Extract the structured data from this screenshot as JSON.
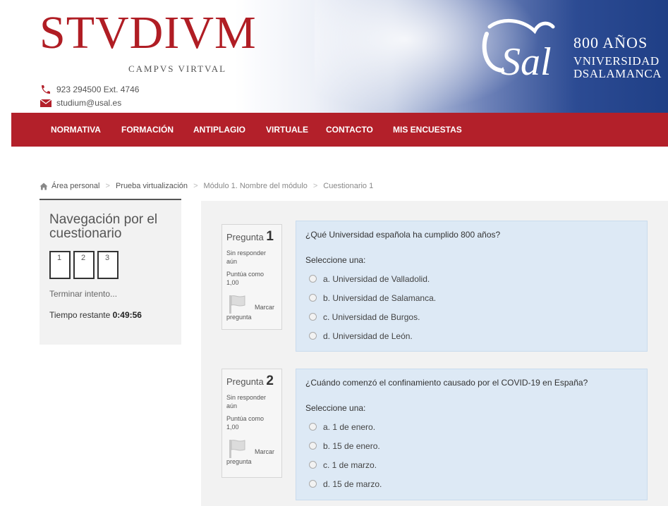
{
  "header": {
    "logo_main": "STVDIVM",
    "logo_sub": "CAMPVS VIRTVAL",
    "phone": "923 294500 Ext. 4746",
    "email": "studium@usal.es",
    "usal_monogram": "Usal",
    "usal_years": "800 AÑOS",
    "usal_line1": "VNIVERSIDAD",
    "usal_line2": "DSALAMANCA"
  },
  "nav": {
    "items": [
      "NORMATIVA",
      "FORMACIÓN",
      "ANTIPLAGIO",
      "VIRTUALE",
      "CONTACTO",
      "MIS ENCUESTAS"
    ]
  },
  "breadcrumb": {
    "items": [
      "Área personal",
      "Prueba virtualización",
      "Módulo 1. Nombre del módulo",
      "Cuestionario 1"
    ]
  },
  "quiz_nav": {
    "title": "Navegación por el cuestionario",
    "buttons": [
      "1",
      "2",
      "3"
    ],
    "finish_label": "Terminar intento...",
    "timer_label": "Tiempo restante",
    "timer_value": "0:49:56"
  },
  "questions": [
    {
      "label": "Pregunta",
      "number": "1",
      "state": "Sin responder aún",
      "grade": "Puntúa como 1,00",
      "flag_l1": "Marcar",
      "flag_l2": "pregunta",
      "text": "¿Qué Universidad española ha cumplido 800 años?",
      "prompt": "Seleccione una:",
      "answers": [
        "a. Universidad de Valladolid.",
        "b. Universidad de Salamanca.",
        "c. Universidad de Burgos.",
        "d. Universidad de León."
      ]
    },
    {
      "label": "Pregunta",
      "number": "2",
      "state": "Sin responder aún",
      "grade": "Puntúa como 1,00",
      "flag_l1": "Marcar",
      "flag_l2": "pregunta",
      "text": "¿Cuándo comenzó el confinamiento causado por el COVID-19 en España?",
      "prompt": "Seleccione una:",
      "answers": [
        "a. 1 de enero.",
        "b. 15 de enero.",
        "c. 1 de marzo.",
        "d. 15 de marzo."
      ]
    }
  ],
  "colors": {
    "brand_red": "#b3202a",
    "question_bg": "#dde9f5",
    "header_blue": "#2c4b93"
  }
}
